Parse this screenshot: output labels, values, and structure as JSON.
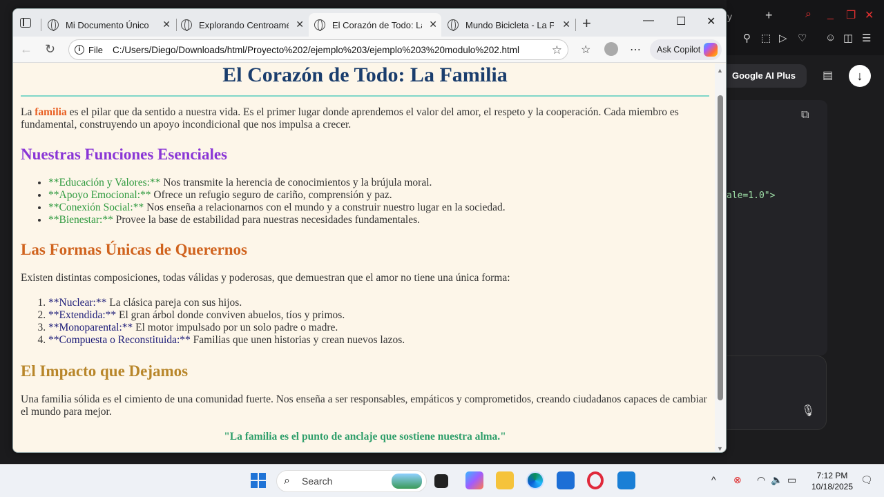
{
  "browser": {
    "tabs": [
      {
        "label": "Mi Documento Único",
        "active": false
      },
      {
        "label": "Explorando Centroamérica",
        "active": false
      },
      {
        "label": "El Corazón de Todo: La Familia",
        "active": true
      },
      {
        "label": "Mundo Bicicleta - La Pasión",
        "active": false
      }
    ],
    "file_label": "File",
    "url": "C:/Users/Diego/Downloads/html/Proyecto%202/ejemplo%203/ejemplo%203%20modulo%202.html",
    "copilot_label": "Ask Copilot"
  },
  "page": {
    "title": "El Corazón de Todo: La Familia",
    "intro_pre": "La",
    "intro_highlight": "familia",
    "intro_post": "es el pilar que da sentido a nuestra vida. Es el primer lugar donde aprendemos el valor del amor, el respeto y la cooperación. Cada miembro es fundamental, construyendo un apoyo incondicional que nos impulsa a crecer.",
    "section1_title": "Nuestras Funciones Esenciales",
    "functions": [
      {
        "term": "**Educación y Valores:**",
        "text": "Nos transmite la herencia de conocimientos y la brújula moral."
      },
      {
        "term": "**Apoyo Emocional:**",
        "text": "Ofrece un refugio seguro de cariño, comprensión y paz."
      },
      {
        "term": "**Conexión Social:**",
        "text": "Nos enseña a relacionarnos con el mundo y a construir nuestro lugar en la sociedad."
      },
      {
        "term": "**Bienestar:**",
        "text": "Provee la base de estabilidad para nuestras necesidades fundamentales."
      }
    ],
    "section2_title": "Las Formas Únicas de Querernos",
    "section2_intro": "Existen distintas composiciones, todas válidas y poderosas, que demuestran que el amor no tiene una única forma:",
    "forms": [
      {
        "term": "**Nuclear:**",
        "text": "La clásica pareja con sus hijos."
      },
      {
        "term": "**Extendida:**",
        "text": "El gran árbol donde conviven abuelos, tíos y primos."
      },
      {
        "term": "**Monoparental:**",
        "text": "El motor impulsado por un solo padre o madre."
      },
      {
        "term": "**Compuesta o Reconstituida:**",
        "text": "Familias que unen historias y crean nuevos lazos."
      }
    ],
    "section3_title": "El Impacto que Dejamos",
    "section3_text": "Una familia sólida es el cimiento de una comunidad fuerte. Nos enseña a ser responsables, empáticos y comprometidos, creando ciudadanos capaces de cambiar el mundo para mejor.",
    "quote": "\"La familia es el punto de anclaje que sostiene nuestra alma.\""
  },
  "background_app": {
    "tab_fragment": "y",
    "pill_label": "Google AI Plus",
    "code_fragment": "ale=1.0\">"
  },
  "taskbar": {
    "search_placeholder": "Search",
    "time": "7:12 PM",
    "date": "10/18/2025"
  }
}
